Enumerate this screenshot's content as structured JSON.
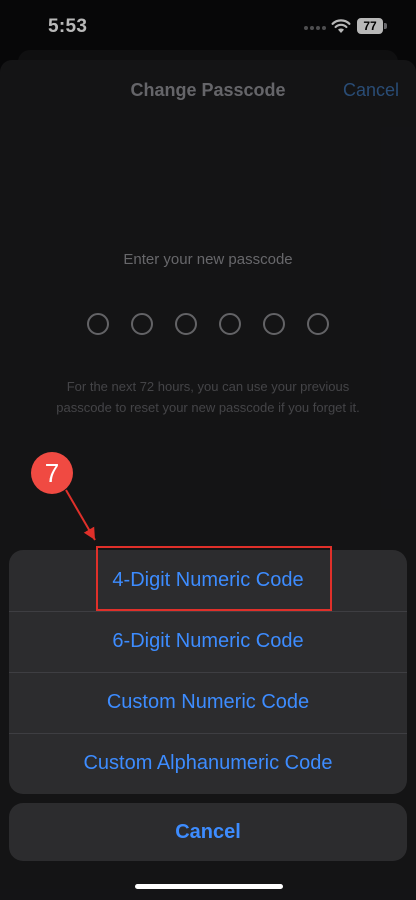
{
  "status_bar": {
    "time": "5:53",
    "battery": "77"
  },
  "sheet": {
    "title": "Change Passcode",
    "cancel_label": "Cancel",
    "prompt": "Enter your new passcode",
    "passcode_length": 6,
    "hint": "For the next 72 hours, you can use your previous passcode to reset your new passcode if you forget it."
  },
  "action_sheet": {
    "options": [
      {
        "label": "4-Digit Numeric Code"
      },
      {
        "label": "6-Digit Numeric Code"
      },
      {
        "label": "Custom Numeric Code"
      },
      {
        "label": "Custom Alphanumeric Code"
      }
    ],
    "cancel_label": "Cancel"
  },
  "annotation": {
    "step_number": "7",
    "color": "#e0302a"
  },
  "colors": {
    "accent": "#3d8cff",
    "sheet_background": "#1c1c1e",
    "action_background": "#2c2c2e"
  }
}
